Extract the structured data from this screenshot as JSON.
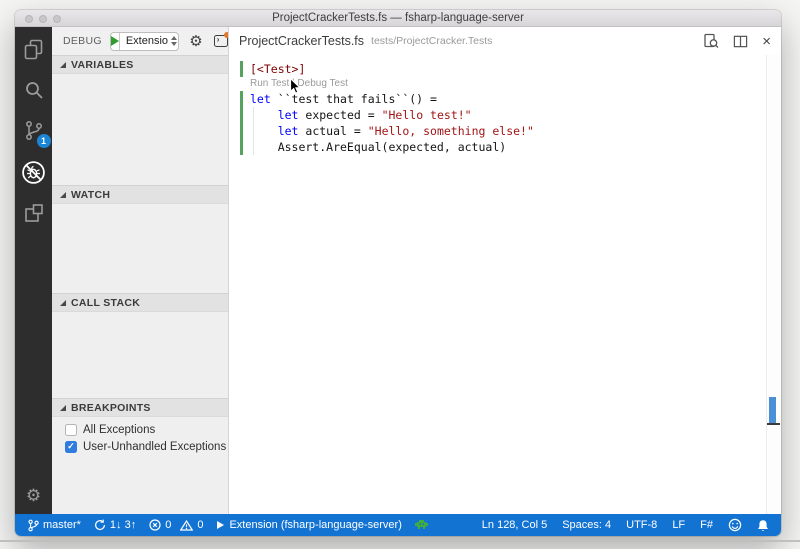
{
  "window": {
    "title": "ProjectCrackerTests.fs — fsharp-language-server"
  },
  "activity_bar": {
    "scm_badge": "1"
  },
  "debug_toolbar": {
    "label": "DEBUG",
    "config_value": "Extensio"
  },
  "sidebar": {
    "sections": {
      "variables": "VARIABLES",
      "watch": "WATCH",
      "call_stack": "CALL STACK",
      "breakpoints": "BREAKPOINTS"
    },
    "breakpoints": [
      {
        "label": "All Exceptions",
        "checked": false
      },
      {
        "label": "User-Unhandled Exceptions",
        "checked": true
      }
    ]
  },
  "editor": {
    "tab": {
      "title": "ProjectCrackerTests.fs",
      "description": "tests/ProjectCracker.Tests"
    },
    "code": {
      "lines": [
        {
          "tokens": [
            {
              "type": "attr",
              "text": "[<Test>]"
            }
          ]
        },
        {
          "codelens": "Run Test | Debug Test"
        },
        {
          "tokens": [
            {
              "type": "keyword",
              "text": "let "
            },
            {
              "type": "plain",
              "text": "``test that fails``() ="
            }
          ]
        },
        {
          "tokens": [
            {
              "type": "plain",
              "text": "    "
            },
            {
              "type": "keyword",
              "text": "let "
            },
            {
              "type": "plain",
              "text": "expected = "
            },
            {
              "type": "string",
              "text": "\"Hello test!\""
            }
          ]
        },
        {
          "tokens": [
            {
              "type": "plain",
              "text": "    "
            },
            {
              "type": "keyword",
              "text": "let "
            },
            {
              "type": "plain",
              "text": "actual = "
            },
            {
              "type": "string",
              "text": "\"Hello, something else!\""
            }
          ]
        },
        {
          "tokens": [
            {
              "type": "plain",
              "text": "    Assert.AreEqual(expected, actual)"
            }
          ]
        }
      ]
    }
  },
  "status_bar": {
    "branch": "master*",
    "sync": "1↓ 3↑",
    "errors": "0",
    "warnings": "0",
    "task": "Extension (fsharp-language-server)",
    "cursor": "Ln 128, Col 5",
    "indentation": "Spaces: 4",
    "encoding": "UTF-8",
    "eol": "LF",
    "language": "F#"
  },
  "colors": {
    "status_bar": "#1373d2",
    "scm_badge": "#1a85d6",
    "modified_gutter_green": "#56a25f",
    "keyword_blue": "#0000ff",
    "string_red": "#a31515",
    "attribute_maroon": "#800000",
    "play_green": "#2f9e2f",
    "console_badge_orange": "#e2762b"
  }
}
